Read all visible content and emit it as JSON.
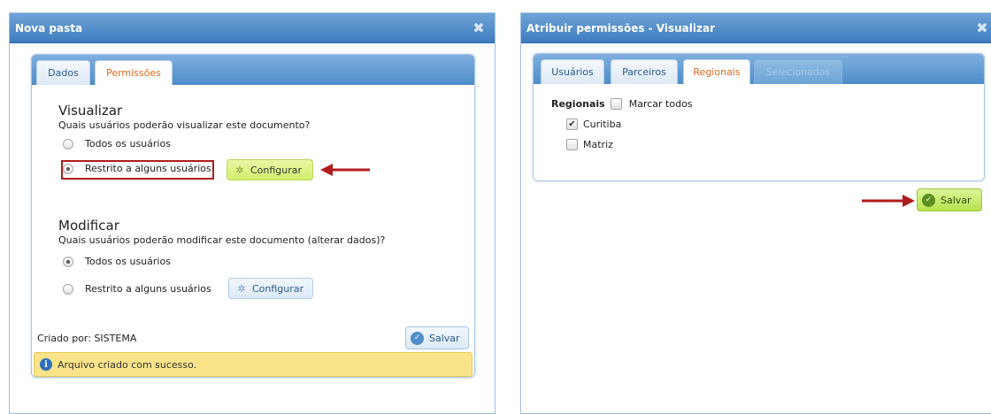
{
  "left_dialog": {
    "title": "Nova pasta",
    "tabs": [
      {
        "label": "Dados",
        "active": false
      },
      {
        "label": "Permissões",
        "active": true
      }
    ],
    "visualizar": {
      "heading": "Visualizar",
      "question": "Quais usuários poderão visualizar este documento?",
      "options": [
        "Todos os usuários",
        "Restrito a alguns usuários"
      ],
      "selected": "Restrito a alguns usuários",
      "configure_label": "Configurar"
    },
    "modificar": {
      "heading": "Modificar",
      "question": "Quais usuários poderão modificar este documento (alterar dados)?",
      "options": [
        "Todos os usuários",
        "Restrito a alguns usuários"
      ],
      "selected": "Todos os usuários",
      "configure_label": "Configurar"
    },
    "created_by": "Criado por: SISTEMA",
    "save_label": "Salvar",
    "notice": "Arquivo criado com sucesso."
  },
  "right_dialog": {
    "title": "Atribuir permissões - Visualizar",
    "tabs": [
      {
        "label": "Usuários",
        "state": "inactive"
      },
      {
        "label": "Parceiros",
        "state": "inactive"
      },
      {
        "label": "Regionais",
        "state": "active"
      },
      {
        "label": "Selecionados",
        "state": "disabled"
      }
    ],
    "section_label": "Regionais",
    "select_all_label": "Marcar todos",
    "select_all_checked": false,
    "items": [
      {
        "label": "Curitiba",
        "checked": true
      },
      {
        "label": "Matriz",
        "checked": false
      }
    ],
    "save_label": "Salvar"
  },
  "colors": {
    "title_bar": "#4f8cc9",
    "active_tab_text": "#e06a1e",
    "highlight_red": "#b01c1c",
    "configure_green": "#d3ef6b",
    "notice_yellow": "#fbe38a"
  },
  "icons": [
    "close-icon",
    "gear-icon",
    "check-circle-icon",
    "info-icon",
    "checkmark-icon"
  ]
}
